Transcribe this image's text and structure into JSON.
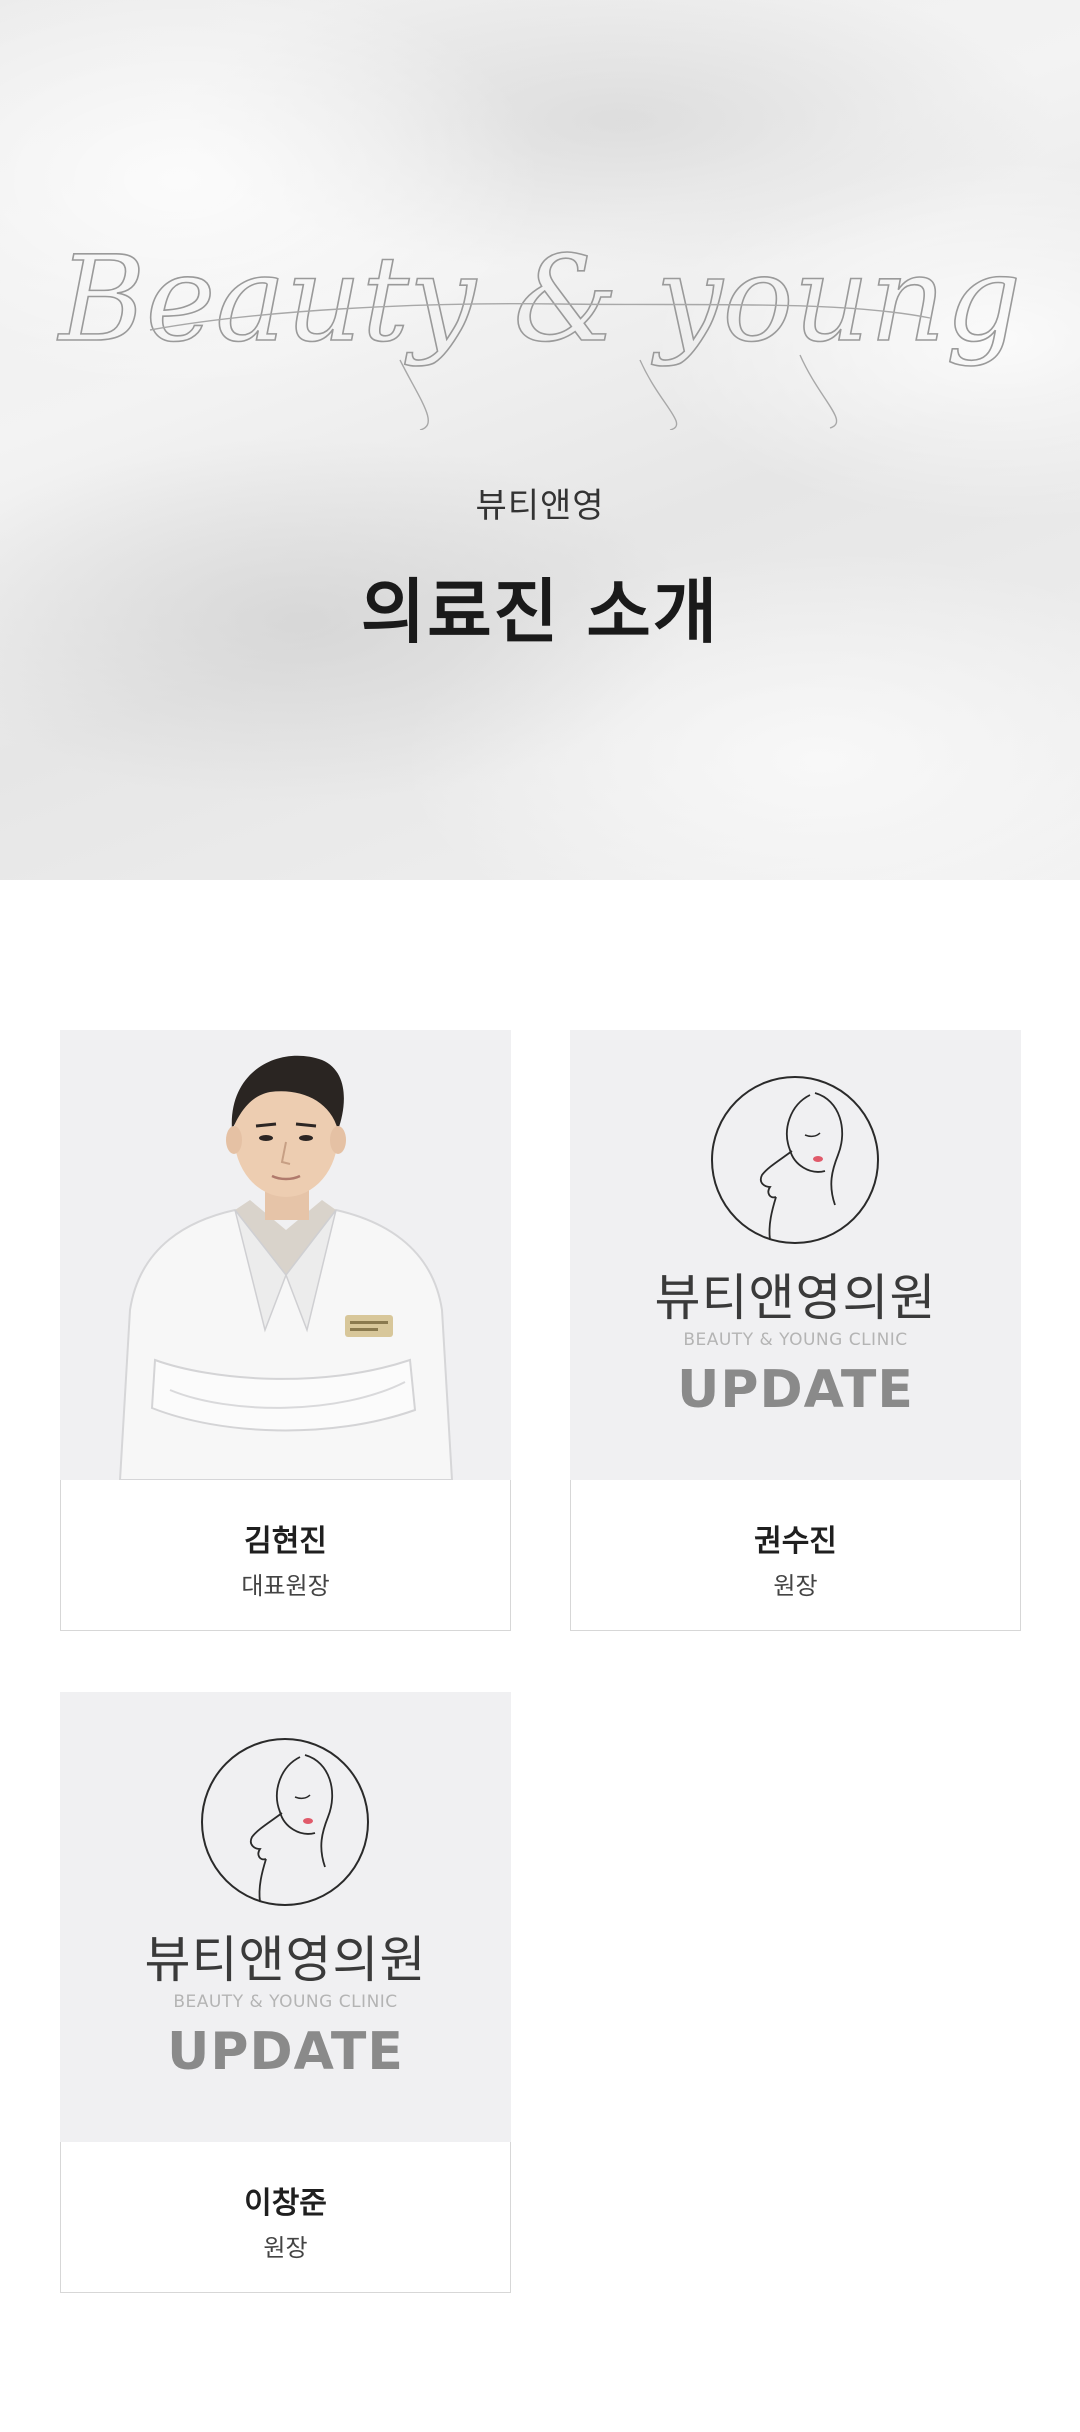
{
  "hero": {
    "script_title": "Beauty & young",
    "subtitle": "뷰티앤영",
    "title": "의료진 소개"
  },
  "placeholder": {
    "logo_icon": "face-line-logo-icon",
    "clinic_name_kr": "뷰티앤영의원",
    "clinic_name_en": "BEAUTY & YOUNG CLINIC",
    "update_label": "UPDATE"
  },
  "doctors": [
    {
      "name": "김현진",
      "role": "대표원장",
      "photo": "doctor-photo"
    },
    {
      "name": "권수진",
      "role": "원장",
      "photo": "placeholder"
    },
    {
      "name": "이창준",
      "role": "원장",
      "photo": "placeholder"
    }
  ],
  "colors": {
    "tile_background": "#f0f0f2",
    "caption_border": "#d7d7d7",
    "update_gray": "#8a8a8a",
    "lip_accent": "#e05a6a"
  }
}
